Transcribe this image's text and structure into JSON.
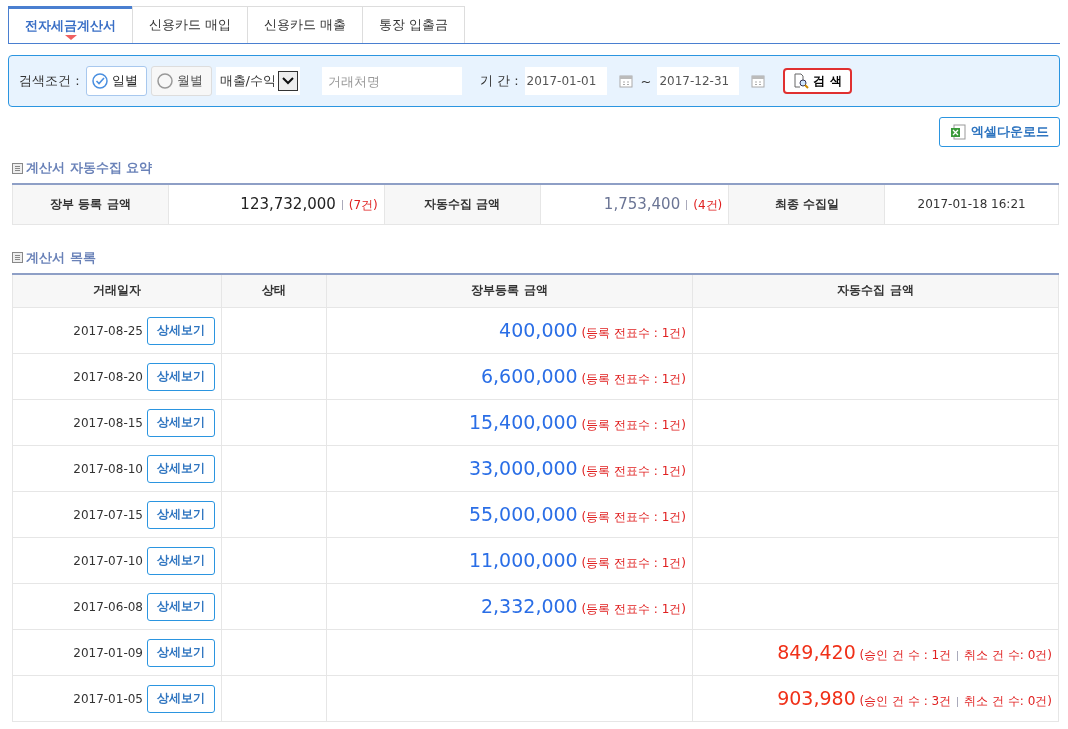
{
  "tabs": [
    {
      "label": "전자세금계산서",
      "selected": true
    },
    {
      "label": "신용카드 매입",
      "selected": false
    },
    {
      "label": "신용카드 매출",
      "selected": false
    },
    {
      "label": "통장 입출금",
      "selected": false
    }
  ],
  "search": {
    "label": "검색조건 :",
    "periods": [
      {
        "label": "일별",
        "selected": true
      },
      {
        "label": "월별",
        "selected": false
      }
    ],
    "type_select": "매출/수익",
    "partner": {
      "placeholder": "거래처명"
    },
    "period_label": "기 간 :",
    "date_from": "2017-01-01",
    "tilde": "~",
    "date_to": "2017-12-31",
    "button": "검 색"
  },
  "excel_button": "엑셀다운로드",
  "summary": {
    "title": "계산서 자동수집 요약",
    "items": [
      {
        "label": "장부 등록 금액",
        "value": "123,732,000",
        "count": "(7건)"
      },
      {
        "label": "자동수집 금액",
        "value": "1,753,400",
        "count": "(4건)"
      },
      {
        "label": "최종 수집일",
        "value": "2017-01-18 16:21"
      }
    ]
  },
  "list": {
    "title": "계산서 목록",
    "columns": [
      "거래일자",
      "상태",
      "장부등록 금액",
      "자동수집 금액"
    ],
    "rows": [
      {
        "date": "2017-08-25",
        "button": "상세보기",
        "book_amount": "400,000",
        "book_note": "(등록 전표수 : 1건)"
      },
      {
        "date": "2017-08-20",
        "button": "상세보기",
        "book_amount": "6,600,000",
        "book_note": "(등록 전표수 : 1건)"
      },
      {
        "date": "2017-08-15",
        "button": "상세보기",
        "book_amount": "15,400,000",
        "book_note": "(등록 전표수 : 1건)"
      },
      {
        "date": "2017-08-10",
        "button": "상세보기",
        "book_amount": "33,000,000",
        "book_note": "(등록 전표수 : 1건)"
      },
      {
        "date": "2017-07-15",
        "button": "상세보기",
        "book_amount": "55,000,000",
        "book_note": "(등록 전표수 : 1건)"
      },
      {
        "date": "2017-07-10",
        "button": "상세보기",
        "book_amount": "11,000,000",
        "book_note": "(등록 전표수 : 1건)"
      },
      {
        "date": "2017-06-08",
        "button": "상세보기",
        "book_amount": "2,332,000",
        "book_note": "(등록 전표수 : 1건)"
      },
      {
        "date": "2017-01-09",
        "button": "상세보기",
        "auto_amount": "849,420",
        "auto_approved": "(승인 건 수 : 1건",
        "auto_canceled": "취소 건 수: 0건)"
      },
      {
        "date": "2017-01-05",
        "button": "상세보기",
        "auto_amount": "903,980",
        "auto_approved": "(승인 건 수 : 3건",
        "auto_canceled": "취소 건 수: 0건)"
      }
    ]
  }
}
